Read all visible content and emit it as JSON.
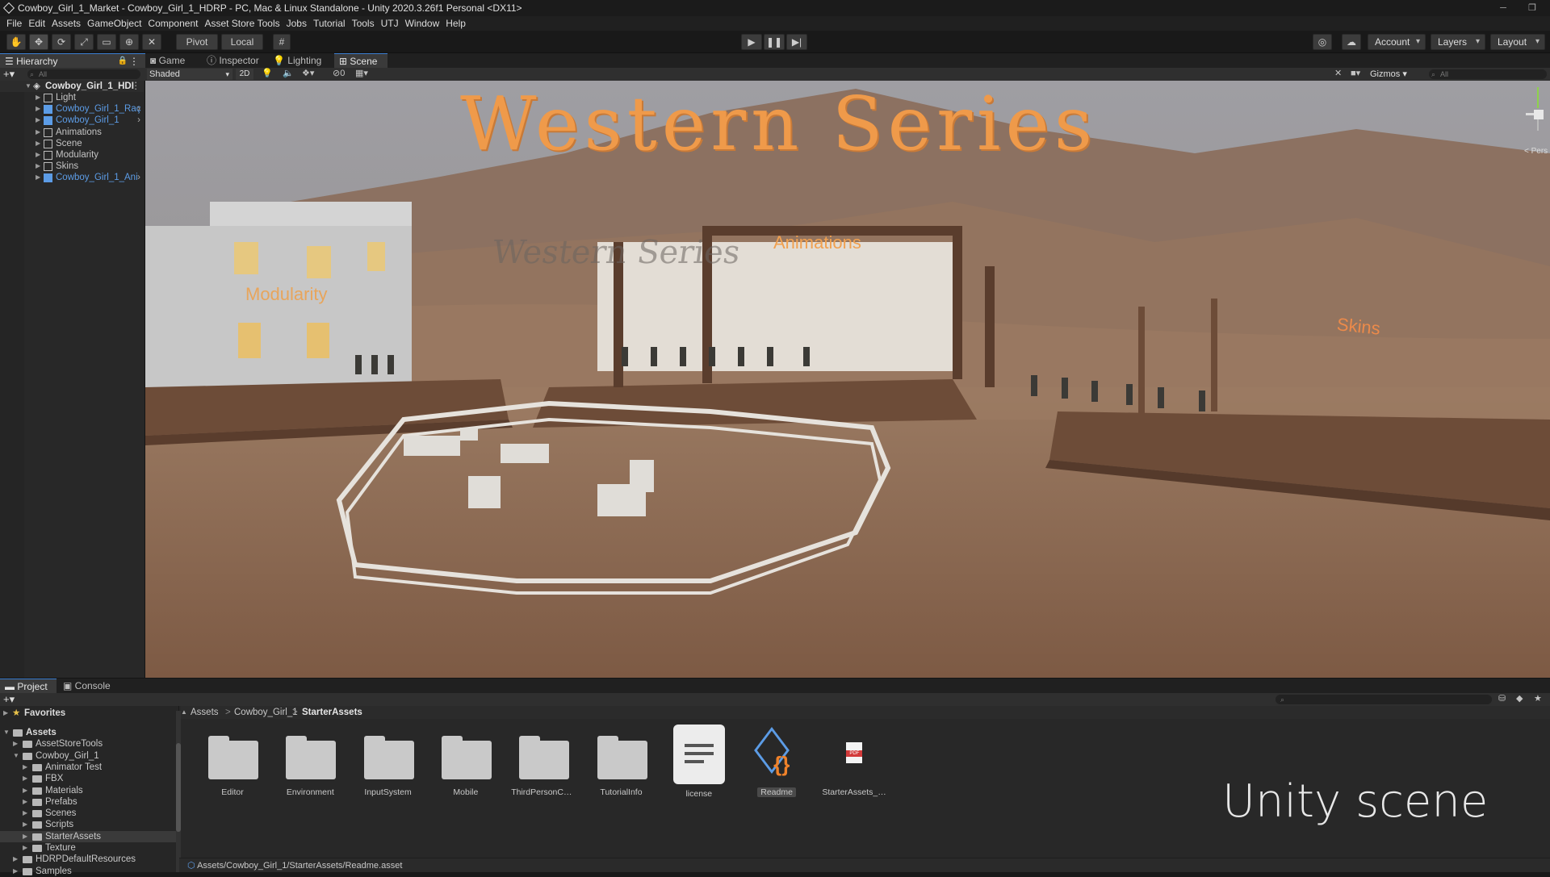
{
  "window": {
    "title": "Cowboy_Girl_1_Market - Cowboy_Girl_1_HDRP - PC, Mac & Linux Standalone - Unity 2020.3.26f1 Personal <DX11>"
  },
  "menu": [
    "File",
    "Edit",
    "Assets",
    "GameObject",
    "Component",
    "Asset Store Tools",
    "Jobs",
    "Tutorial",
    "Tools",
    "UTJ",
    "Window",
    "Help"
  ],
  "toolbar": {
    "pivot": "Pivot",
    "local": "Local",
    "account": "Account",
    "layers": "Layers",
    "layout": "Layout"
  },
  "hierarchy": {
    "tab": "Hierarchy",
    "search_placeholder": "All",
    "root": "Cowboy_Girl_1_HDI",
    "items": [
      {
        "label": "Light",
        "prefab": false
      },
      {
        "label": "Cowboy_Girl_1_Raç",
        "prefab": true
      },
      {
        "label": "Cowboy_Girl_1",
        "prefab": true
      },
      {
        "label": "Animations",
        "prefab": false
      },
      {
        "label": "Scene",
        "prefab": false
      },
      {
        "label": "Modularity",
        "prefab": false
      },
      {
        "label": "Skins",
        "prefab": false
      },
      {
        "label": "Cowboy_Girl_1_Ani",
        "prefab": true
      }
    ]
  },
  "scene_tabs": [
    "Game",
    "Inspector",
    "Lighting",
    "Scene"
  ],
  "scene_toolbar": {
    "shading": "Shaded",
    "mode2d": "2D",
    "hidden_count": "0",
    "gizmos": "Gizmos",
    "search_placeholder": "All",
    "persp": "< Pers"
  },
  "scene_text": {
    "title": "Western Series",
    "sign_animations": "Animations",
    "sign_modularity": "Modularity",
    "sign_skins": "Skins",
    "shadow_text": "Western Series"
  },
  "project": {
    "tabs": [
      "Project",
      "Console"
    ],
    "favorites": "Favorites",
    "tree": [
      {
        "label": "Assets",
        "depth": 0,
        "bold": true
      },
      {
        "label": "AssetStoreTools",
        "depth": 1
      },
      {
        "label": "Cowboy_Girl_1",
        "depth": 1
      },
      {
        "label": "Animator Test",
        "depth": 2
      },
      {
        "label": "FBX",
        "depth": 2
      },
      {
        "label": "Materials",
        "depth": 2
      },
      {
        "label": "Prefabs",
        "depth": 2
      },
      {
        "label": "Scenes",
        "depth": 2
      },
      {
        "label": "Scripts",
        "depth": 2
      },
      {
        "label": "StarterAssets",
        "depth": 2,
        "selected": true
      },
      {
        "label": "Texture",
        "depth": 2
      },
      {
        "label": "HDRPDefaultResources",
        "depth": 1
      },
      {
        "label": "Samples",
        "depth": 1
      }
    ],
    "breadcrumb": [
      "Assets",
      "Cowboy_Girl_1",
      "StarterAssets"
    ],
    "assets": [
      {
        "label": "Editor",
        "kind": "folder"
      },
      {
        "label": "Environment",
        "kind": "folder"
      },
      {
        "label": "InputSystem",
        "kind": "folder"
      },
      {
        "label": "Mobile",
        "kind": "folder"
      },
      {
        "label": "ThirdPersonContr...",
        "kind": "folder"
      },
      {
        "label": "TutorialInfo",
        "kind": "folder"
      },
      {
        "label": "license",
        "kind": "text"
      },
      {
        "label": "Readme",
        "kind": "script"
      },
      {
        "label": "StarterAssets_Do...",
        "kind": "pdf"
      }
    ],
    "status_path": "Assets/Cowboy_Girl_1/StarterAssets/Readme.asset",
    "overlay_text": "Unity scene"
  },
  "colors": {
    "accent": "#3d7fd1",
    "prefab": "#5c9ce6",
    "sign": "#f0a050"
  }
}
